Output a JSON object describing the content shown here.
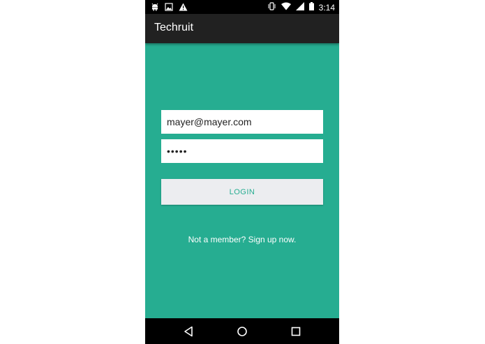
{
  "status_bar": {
    "time": "3:14",
    "left_icons": [
      "android-debug-icon",
      "image-icon",
      "warning-icon"
    ],
    "right_icons": [
      "vibrate-icon",
      "wifi-icon",
      "signal-icon",
      "battery-icon"
    ]
  },
  "app_bar": {
    "title": "Techruit"
  },
  "login_form": {
    "email_value": "mayer@mayer.com",
    "password_value": "•••••",
    "login_label": "LOGIN",
    "signup_text": "Not a member? Sign up now."
  },
  "nav_bar": {
    "buttons": [
      "back-icon",
      "home-icon",
      "recents-icon"
    ]
  },
  "colors": {
    "background": "#26ad91",
    "app_bar": "#212121",
    "button_bg": "#ecedf0",
    "button_text": "#26ad91"
  }
}
